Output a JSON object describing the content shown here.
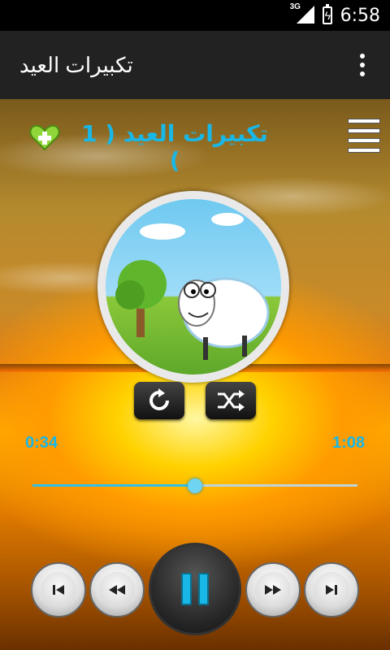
{
  "status": {
    "network": "3G",
    "time": "6:58"
  },
  "appbar": {
    "title": "تكبيرات العيد",
    "overflow_icon": "overflow-menu-icon"
  },
  "player": {
    "track_title": "تكبيرات العيد ( 1 )",
    "favorite_icon": "heart-plus-icon",
    "menu_icon": "hamburger-icon",
    "repeat_icon": "repeat-icon",
    "shuffle_icon": "shuffle-icon",
    "elapsed": "0:34",
    "duration": "1:08",
    "progress": 0.5,
    "accent": "#19b7e6",
    "controls": [
      "skip-previous-icon",
      "rewind-icon",
      "pause-icon",
      "fast-forward-icon",
      "skip-next-icon"
    ]
  }
}
